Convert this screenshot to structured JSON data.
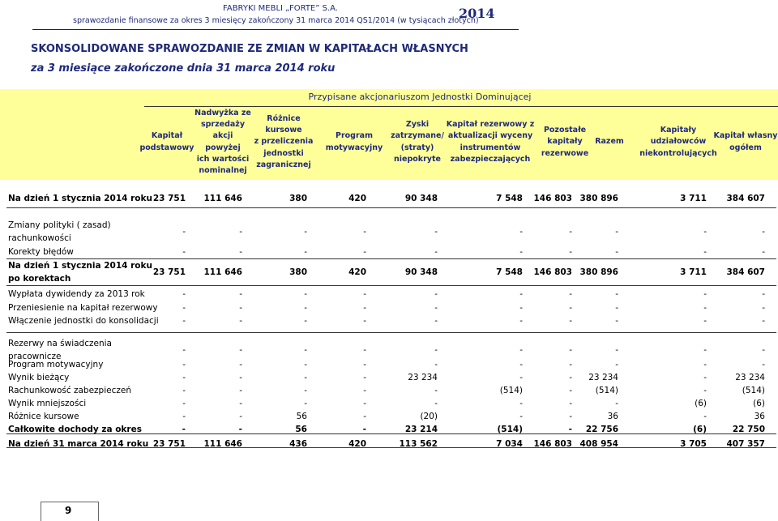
{
  "header": {
    "company": "FABRYKI MEBLI „FORTE” S.A.",
    "subtitle": "sprawozdanie finansowe za okres 3 miesięcy zakończony 31 marca 2014 QS1/2014 (w tysiącach złotych)",
    "year": "2014"
  },
  "title": "SKONSOLIDOWANE SPRAWOZDANIE ZE ZMIAN W KAPITAŁACH WŁASNYCH",
  "subtitle": "za 3 miesiące zakończone dnia 31 marca 2014 roku",
  "attrib": "Przypisane akcjonariuszom Jednostki Dominującej",
  "columns": [
    [
      "Kapitał",
      "podstawowy"
    ],
    [
      "Nadwyżka ze",
      "sprzedaży",
      "akcji powyżej",
      "ich wartości",
      "nominalnej"
    ],
    [
      "Różnice",
      "kursowe",
      "z przeliczenia",
      "jednostki",
      "zagranicznej"
    ],
    [
      "Program",
      "motywacyjny"
    ],
    [
      "Zyski",
      "zatrzymane/",
      "(straty)",
      "niepokryte"
    ],
    [
      "Kapitał rezerwowy z",
      "aktualizacji wyceny",
      "instrumentów",
      "zabezpieczających"
    ],
    [
      "Pozostałe",
      "kapitały",
      "rezerwowe"
    ],
    [
      "Razem"
    ],
    [
      "Kapitały",
      "udziałowców",
      "niekontrolujących"
    ],
    [
      "Kapitał własny",
      "ogółem"
    ]
  ],
  "rows": [
    {
      "label": [
        "Na dzień 1 stycznia 2014 roku"
      ],
      "bold": true,
      "values": [
        "23 751",
        "111 646",
        "380",
        "420",
        "90 348",
        "7 548",
        "146 803",
        "380 896",
        "3 711",
        "384 607"
      ]
    },
    {
      "label": [
        "Zmiany polityki ( zasad)",
        "rachunkowości"
      ],
      "bold": false,
      "values": [
        "-",
        "-",
        "-",
        "-",
        "-",
        "-",
        "-",
        "-",
        "-",
        "-"
      ]
    },
    {
      "label": [
        "Korekty błędów"
      ],
      "bold": false,
      "values": [
        "-",
        "-",
        "-",
        "-",
        "-",
        "-",
        "-",
        "-",
        "-",
        "-"
      ]
    },
    {
      "label": [
        "Na dzień 1 stycznia 2014 roku",
        "po korektach"
      ],
      "bold": true,
      "values": [
        "23 751",
        "111 646",
        "380",
        "420",
        "90 348",
        "7 548",
        "146 803",
        "380 896",
        "3 711",
        "384 607"
      ]
    },
    {
      "label": [
        "Wypłata dywidendy za 2013 rok"
      ],
      "bold": false,
      "values": [
        "-",
        "-",
        "-",
        "-",
        "-",
        "-",
        "-",
        "-",
        "-",
        "-"
      ]
    },
    {
      "label": [
        "Przeniesienie na kapitał rezerwowy"
      ],
      "bold": false,
      "values": [
        "-",
        "-",
        "-",
        "-",
        "-",
        "-",
        "-",
        "-",
        "-",
        "-"
      ]
    },
    {
      "label": [
        "Włączenie jednostki do konsolidacji"
      ],
      "bold": false,
      "values": [
        "-",
        "-",
        "-",
        "-",
        "-",
        "-",
        "-",
        "-",
        "-",
        "-"
      ]
    },
    {
      "label": [
        "Rezerwy na świadczenia",
        "pracownicze"
      ],
      "bold": false,
      "values": [
        "-",
        "-",
        "-",
        "-",
        "-",
        "-",
        "-",
        "-",
        "-",
        "-"
      ]
    },
    {
      "label": [
        "Program motywacyjny"
      ],
      "bold": false,
      "values": [
        "-",
        "-",
        "-",
        "-",
        "-",
        "-",
        "-",
        "-",
        "-",
        "-"
      ]
    },
    {
      "label": [
        "Wynik bieżący"
      ],
      "bold": false,
      "values": [
        "-",
        "-",
        "-",
        "-",
        "23 234",
        "-",
        "-",
        "23 234",
        "-",
        "23 234"
      ]
    },
    {
      "label": [
        "Rachunkowość zabezpieczeń"
      ],
      "bold": false,
      "values": [
        "-",
        "-",
        "-",
        "-",
        "-",
        "(514)",
        "-",
        "(514)",
        "-",
        "(514)"
      ]
    },
    {
      "label": [
        "Wynik mniejszości"
      ],
      "bold": false,
      "values": [
        "-",
        "-",
        "-",
        "-",
        "-",
        "-",
        "-",
        "-",
        "(6)",
        "(6)"
      ]
    },
    {
      "label": [
        "Różnice kursowe"
      ],
      "bold": false,
      "values": [
        "-",
        "-",
        "56",
        "-",
        "(20)",
        "-",
        "-",
        "36",
        "-",
        "36"
      ]
    },
    {
      "label": [
        "Całkowite dochody za okres"
      ],
      "bold": true,
      "values": [
        "-",
        "-",
        "56",
        "-",
        "23 214",
        "(514)",
        "-",
        "22 756",
        "(6)",
        "22 750"
      ]
    },
    {
      "label": [
        "Na dzień 31 marca 2014 roku"
      ],
      "bold": true,
      "values": [
        "23 751",
        "111 646",
        "436",
        "420",
        "113 562",
        "7 034",
        "146 803",
        "408 954",
        "3 705",
        "407 357"
      ]
    }
  ],
  "page_number": "9",
  "colors": {
    "header_blue": "#1f2a7a",
    "header_fill": "#ffff99"
  }
}
